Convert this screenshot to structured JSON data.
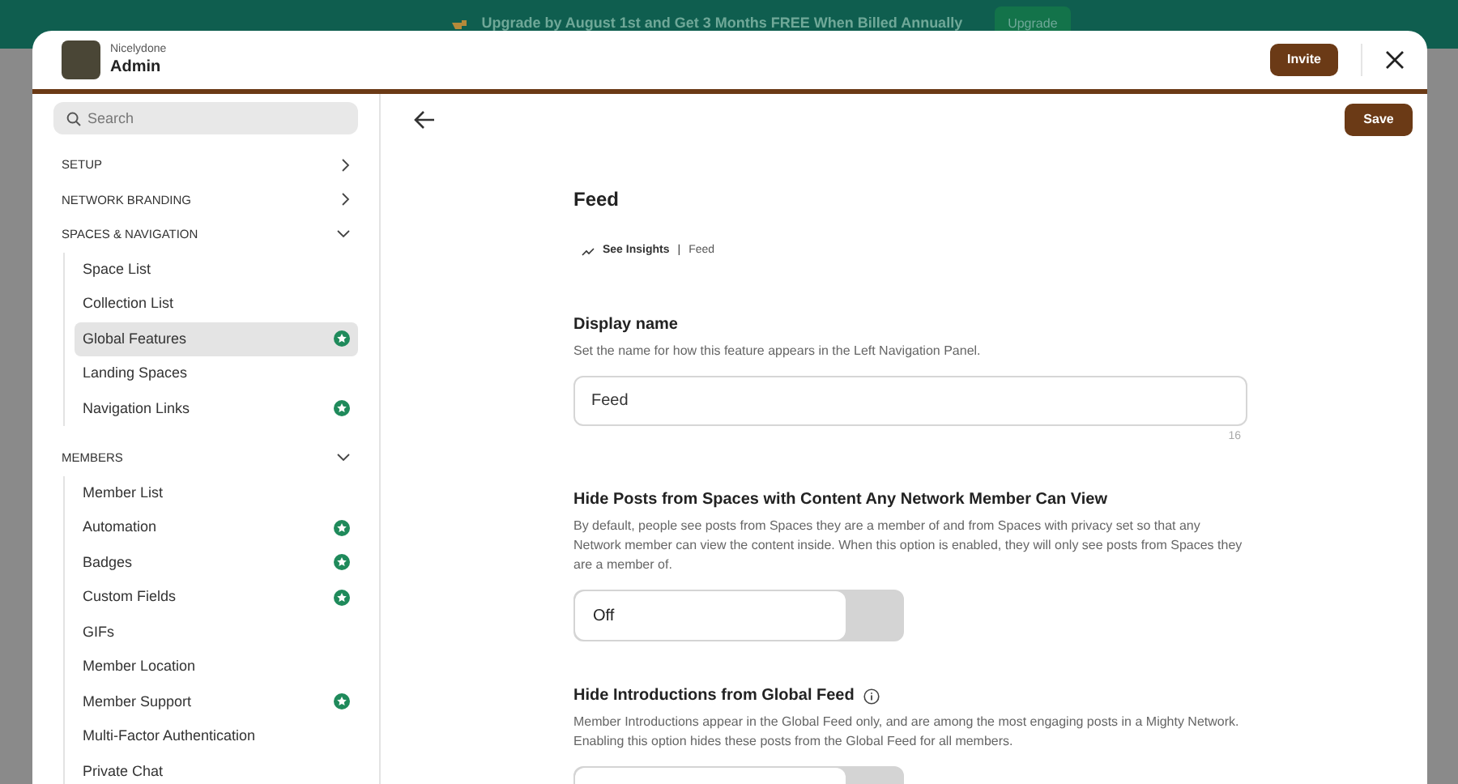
{
  "banner": {
    "text": "Upgrade by August 1st and Get 3 Months FREE When Billed Annually",
    "button": "Upgrade"
  },
  "header": {
    "network": "Nicelydone",
    "title": "Admin",
    "invite": "Invite"
  },
  "sidebar": {
    "search": {
      "placeholder": "Search"
    },
    "sections": [
      {
        "label": "SETUP",
        "expanded": false
      },
      {
        "label": "NETWORK BRANDING",
        "expanded": false
      },
      {
        "label": "SPACES & NAVIGATION",
        "expanded": true,
        "items": [
          {
            "label": "Space List",
            "selected": false,
            "premium": false
          },
          {
            "label": "Collection List",
            "selected": false,
            "premium": false
          },
          {
            "label": "Global Features",
            "selected": true,
            "premium": true
          },
          {
            "label": "Landing Spaces",
            "selected": false,
            "premium": false
          },
          {
            "label": "Navigation Links",
            "selected": false,
            "premium": true
          }
        ]
      },
      {
        "label": "MEMBERS",
        "expanded": true,
        "items": [
          {
            "label": "Member List",
            "selected": false,
            "premium": false
          },
          {
            "label": "Automation",
            "selected": false,
            "premium": true
          },
          {
            "label": "Badges",
            "selected": false,
            "premium": true
          },
          {
            "label": "Custom Fields",
            "selected": false,
            "premium": true
          },
          {
            "label": "GIFs",
            "selected": false,
            "premium": false
          },
          {
            "label": "Member Location",
            "selected": false,
            "premium": false
          },
          {
            "label": "Member Support",
            "selected": false,
            "premium": true
          },
          {
            "label": "Multi-Factor Authentication",
            "selected": false,
            "premium": false
          },
          {
            "label": "Private Chat",
            "selected": false,
            "premium": false
          }
        ]
      }
    ]
  },
  "main": {
    "save": "Save",
    "title": "Feed",
    "insights": {
      "link": "See Insights",
      "separator": "|",
      "page": "Feed"
    },
    "settings": [
      {
        "kind": "text",
        "title": "Display name",
        "info": false,
        "description": "Set the name for how this feature appears in the Left Navigation Panel.",
        "value": "Feed",
        "count": "16"
      },
      {
        "kind": "toggle",
        "title": "Hide Posts from Spaces with Content Any Network Member Can View",
        "info": false,
        "description": "By default, people see posts from Spaces they are a member of and from Spaces with privacy set so that any Network member can view the content inside. When this option is enabled, they will only see posts from Spaces they are a member of.",
        "value": "Off",
        "on": false
      },
      {
        "kind": "toggle",
        "title": "Hide Introductions from Global Feed",
        "info": true,
        "description": "Member Introductions appear in the Global Feed only, and are among the most engaging posts in a Mighty Network. Enabling this option hides these posts from the Global Feed for all members.",
        "on": false
      }
    ]
  }
}
